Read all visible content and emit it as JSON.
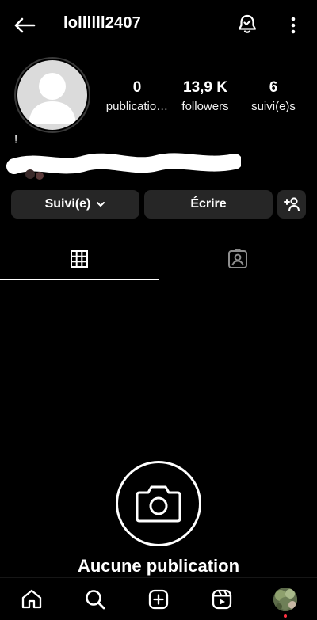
{
  "header": {
    "username": "lollllll2407",
    "back_icon": "arrow-left-icon",
    "bell_icon": "bell-check-icon",
    "more_icon": "vertical-dots-icon"
  },
  "profile": {
    "stats": [
      {
        "value": "0",
        "label": "publicatio…"
      },
      {
        "value": "13,9 K",
        "label": "followers"
      },
      {
        "value": "6",
        "label": "suivi(e)s"
      }
    ],
    "bio_mark": "!"
  },
  "actions": {
    "follow_label": "Suivi(e)",
    "write_label": "Écrire",
    "add_user_icon": "add-person-icon"
  },
  "tabs": [
    {
      "icon": "grid-icon",
      "active": true
    },
    {
      "icon": "tagged-person-icon",
      "active": false
    }
  ],
  "empty_state": {
    "icon": "camera-icon",
    "title": "Aucune publication"
  },
  "bottom_nav": [
    "home-icon",
    "search-icon",
    "create-icon",
    "reels-icon",
    "profile-avatar"
  ],
  "colors": {
    "background": "#000000",
    "button_bg": "#262626",
    "text": "#ffffff",
    "notification_dot": "#ff3040"
  }
}
